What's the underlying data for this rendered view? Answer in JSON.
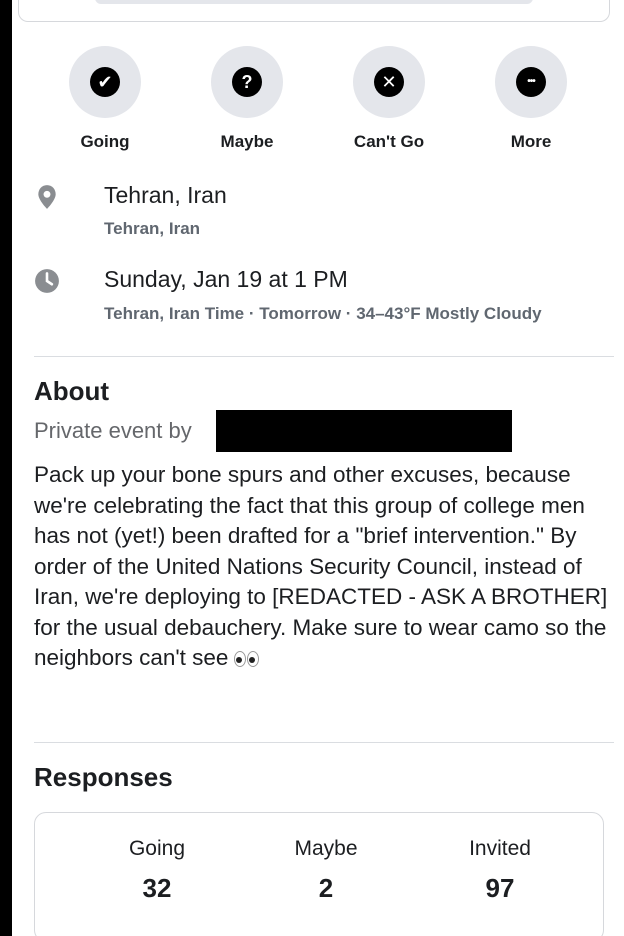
{
  "actions": [
    {
      "label": "Going",
      "icon": "check-icon",
      "glyph": "✔"
    },
    {
      "label": "Maybe",
      "icon": "question-icon",
      "glyph": "?"
    },
    {
      "label": "Can't Go",
      "icon": "close-icon",
      "glyph": "✕"
    },
    {
      "label": "More",
      "icon": "more-icon",
      "glyph": "•••"
    }
  ],
  "location": {
    "name": "Tehran, Iran",
    "detail": "Tehran, Iran"
  },
  "datetime": {
    "when": "Sunday, Jan 19 at 1 PM",
    "detail": "Tehran, Iran Time · Tomorrow · 34–43°F Mostly Cloudy"
  },
  "about": {
    "title": "About",
    "privacy": "Private event by",
    "description": "Pack up your bone spurs and other excuses, because we're celebrating the fact that this group of college men has not (yet!) been drafted for a \"brief intervention.\" By order of the United Nations Security Council, instead of Iran, we're deploying to [REDACTED - ASK A BROTHER] for the usual debauchery. Make sure to wear camo so the neighbors can't see"
  },
  "responses": {
    "title": "Responses",
    "stats": [
      {
        "label": "Going",
        "value": "32"
      },
      {
        "label": "Maybe",
        "value": "2"
      },
      {
        "label": "Invited",
        "value": "97"
      }
    ]
  },
  "colors": {
    "circle_bg": "#e4e6eb",
    "secondary_text": "#606770",
    "icon_gray": "#8a8d91"
  }
}
